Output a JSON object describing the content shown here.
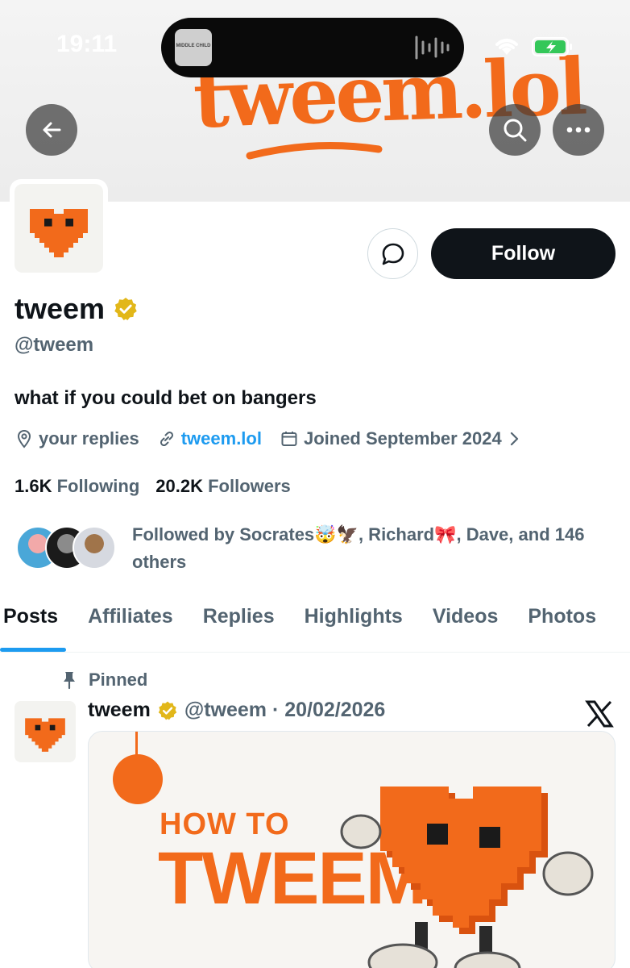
{
  "status_bar": {
    "time": "19:11",
    "now_playing_art_text": "MIDDLE CHILD"
  },
  "banner": {
    "text": "tweem.lol"
  },
  "profile": {
    "display_name": "tweem",
    "handle": "@tweem",
    "bio": "what if you could bet on bangers",
    "location": "your replies",
    "website": "tweem.lol",
    "joined": "Joined September 2024",
    "following_count": "1.6K",
    "following_label": "Following",
    "followers_count": "20.2K",
    "followers_label": "Followers",
    "followed_by": "Followed by Socrates🤯🦅, Richard🎀, Dave, and 146 others",
    "follow_label": "Follow"
  },
  "tabs": [
    "Posts",
    "Affiliates",
    "Replies",
    "Highlights",
    "Videos",
    "Photos"
  ],
  "active_tab": "Posts",
  "pinned_post": {
    "pinned_label": "Pinned",
    "author_name": "tweem",
    "meta": "@tweem · 20/02/2026",
    "media_line1": "HOW TO",
    "media_line2": "TWEEM"
  },
  "colors": {
    "accent": "#1d9bf0",
    "brand_orange": "#f26a1b",
    "text": "#0f1419",
    "muted": "#536471",
    "verified_gold": "#e2b719"
  }
}
